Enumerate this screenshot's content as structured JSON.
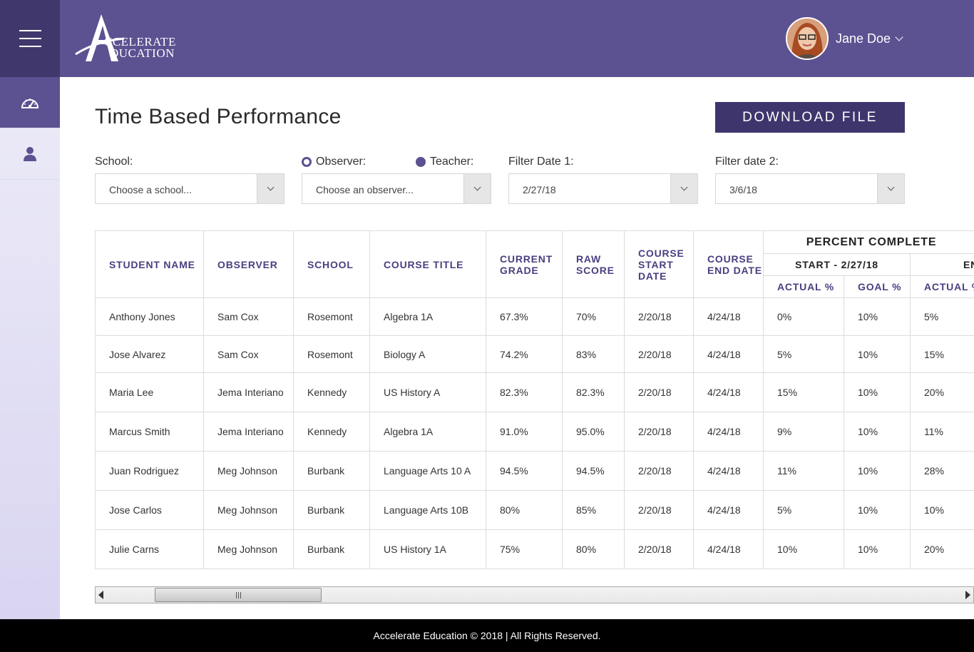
{
  "brand": {
    "line1": "CCELERATE",
    "line2": "DUCATION",
    "monogram": "A",
    "sub_monogram": "E",
    "colors": {
      "primary": "#5c5191",
      "dark": "#40376c",
      "button": "#3f356d",
      "footer": "#000000"
    }
  },
  "header": {
    "menu_icon": "hamburger-icon",
    "user_name": "Jane Doe"
  },
  "sidebar": {
    "items": [
      {
        "icon": "dashboard-gauge-icon",
        "active": true
      },
      {
        "icon": "user-icon",
        "active": false
      }
    ]
  },
  "page": {
    "title": "Time Based Performance",
    "download_label": "DOWNLOAD FILE"
  },
  "filters": {
    "school_label": "School:",
    "school_value": "Choose a school...",
    "observer_label": "Observer:",
    "teacher_label": "Teacher:",
    "observer_value": "Choose an observer...",
    "date1_label": "Filter Date 1:",
    "date1_value": "2/27/18",
    "date2_label": "Filter date 2:",
    "date2_value": "3/6/18"
  },
  "table": {
    "headers": {
      "student": "STUDENT NAME",
      "observer": "OBSERVER",
      "school": "SCHOOL",
      "course": "COURSE TITLE",
      "current_grade": "CURRENT GRADE",
      "raw_score": "RAW SCORE",
      "start_date": "COURSE START DATE",
      "end_date": "COURSE END DATE",
      "percent_complete": "PERCENT COMPLETE",
      "start_group": "START - 2/27/18",
      "end_group": "END",
      "actual1": "ACTUAL %",
      "goal1": "GOAL %",
      "actual2": "ACTUAL %"
    },
    "rows": [
      [
        "Anthony Jones",
        "Sam Cox",
        "Rosemont",
        "Algebra 1A",
        "67.3%",
        "70%",
        "2/20/18",
        "4/24/18",
        "0%",
        "10%",
        "5%"
      ],
      [
        "Jose Alvarez",
        "Sam Cox",
        "Rosemont",
        "Biology A",
        "74.2%",
        "83%",
        "2/20/18",
        "4/24/18",
        "5%",
        "10%",
        "15%"
      ],
      [
        "Maria Lee",
        "Jema Interiano",
        "Kennedy",
        "US History A",
        "82.3%",
        "82.3%",
        "2/20/18",
        "4/24/18",
        "15%",
        "10%",
        "20%"
      ],
      [
        "Marcus Smith",
        "Jema Interiano",
        "Kennedy",
        "Algebra 1A",
        "91.0%",
        "95.0%",
        "2/20/18",
        "4/24/18",
        "9%",
        "10%",
        "11%"
      ],
      [
        "Juan Rodriguez",
        "Meg Johnson",
        "Burbank",
        "Language Arts 10 A",
        "94.5%",
        "94.5%",
        "2/20/18",
        "4/24/18",
        "11%",
        "10%",
        "28%"
      ],
      [
        "Jose Carlos",
        "Meg Johnson",
        "Burbank",
        "Language Arts 10B",
        "80%",
        "85%",
        "2/20/18",
        "4/24/18",
        "5%",
        "10%",
        "10%"
      ],
      [
        "Julie Carns",
        "Meg Johnson",
        "Burbank",
        "US History 1A",
        "75%",
        "80%",
        "2/20/18",
        "4/24/18",
        "10%",
        "10%",
        "20%"
      ]
    ]
  },
  "footer": {
    "text": "Accelerate Education © 2018  |  All Rights Reserved."
  }
}
